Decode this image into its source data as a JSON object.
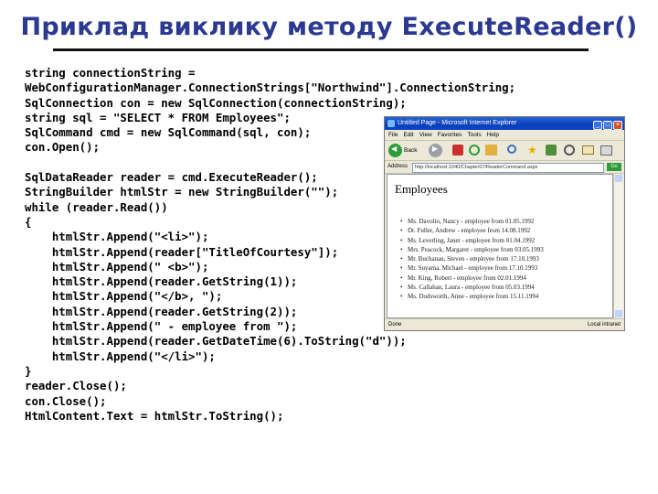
{
  "title": "Приклад виклику методу ExecuteReader()",
  "code_lines": [
    "string connectionString =",
    "WebConfigurationManager.ConnectionStrings[\"Northwind\"].ConnectionString;",
    "SqlConnection con = new SqlConnection(connectionString);",
    "string sql = \"SELECT * FROM Employees\";",
    "SqlCommand cmd = new SqlCommand(sql, con);",
    "con.Open();",
    "",
    "SqlDataReader reader = cmd.ExecuteReader();",
    "StringBuilder htmlStr = new StringBuilder(\"\");",
    "while (reader.Read())",
    "{",
    "    htmlStr.Append(\"<li>\");",
    "    htmlStr.Append(reader[\"TitleOfCourtesy\"]);",
    "    htmlStr.Append(\" <b>\");",
    "    htmlStr.Append(reader.GetString(1));",
    "    htmlStr.Append(\"</b>, \");",
    "    htmlStr.Append(reader.GetString(2));",
    "    htmlStr.Append(\" - employee from \");",
    "    htmlStr.Append(reader.GetDateTime(6).ToString(\"d\"));",
    "    htmlStr.Append(\"</li>\");",
    "}",
    "reader.Close();",
    "con.Close();",
    "HtmlContent.Text = htmlStr.ToString();"
  ],
  "browser": {
    "window_title": "Untitled Page - Microsoft Internet Explorer",
    "menu": [
      "File",
      "Edit",
      "View",
      "Favorites",
      "Tools",
      "Help"
    ],
    "back_label": "Back",
    "address_label": "Address",
    "address_value": "http://localhost:1040/Chapter07/ReaderCommand.aspx",
    "go_label": "Go",
    "page_heading": "Employees",
    "employees": [
      "Ms. Davolio, Nancy - employee from 01.05.1992",
      "Dr. Fuller, Andrew - employee from 14.08.1992",
      "Ms. Leverling, Janet - employee from 01.04.1992",
      "Mrs. Peacock, Margaret - employee from 03.05.1993",
      "Mr. Buchanan, Steven - employee from 17.10.1993",
      "Mr. Suyama, Michael - employee from 17.10.1993",
      "Mr. King, Robert - employee from 02.01.1994",
      "Ms. Callahan, Laura - employee from 05.03.1994",
      "Ms. Dodsworth, Anne - employee from 15.11.1994"
    ],
    "status_text": "Done",
    "status_zone": "Local intranet"
  }
}
